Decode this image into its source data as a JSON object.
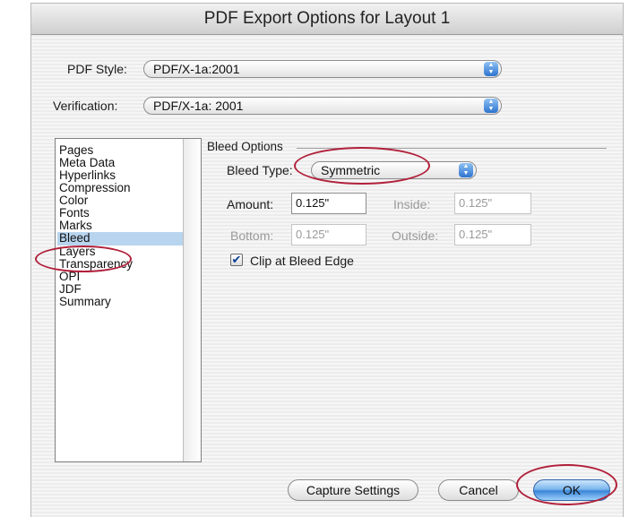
{
  "window": {
    "title": "PDF Export Options for Layout 1"
  },
  "pdf_style": {
    "label": "PDF Style:",
    "value": "PDF/X-1a:2001"
  },
  "verification": {
    "label": "Verification:",
    "value": "PDF/X-1a: 2001"
  },
  "categories": [
    {
      "label": "Pages"
    },
    {
      "label": "Meta Data"
    },
    {
      "label": "Hyperlinks"
    },
    {
      "label": "Compression"
    },
    {
      "label": "Color"
    },
    {
      "label": "Fonts"
    },
    {
      "label": "Marks"
    },
    {
      "label": "Bleed",
      "selected": true
    },
    {
      "label": "Layers"
    },
    {
      "label": "Transparency"
    },
    {
      "label": "OPI"
    },
    {
      "label": "JDF"
    },
    {
      "label": "Summary"
    }
  ],
  "bleed": {
    "group_title": "Bleed Options",
    "type_label": "Bleed Type:",
    "type_value": "Symmetric",
    "amount_label": "Amount:",
    "amount_value": "0.125\"",
    "inside_label": "Inside:",
    "inside_value": "0.125\"",
    "bottom_label": "Bottom:",
    "bottom_value": "0.125\"",
    "outside_label": "Outside:",
    "outside_value": "0.125\"",
    "clip_label": "Clip at Bleed Edge",
    "clip_checked": true
  },
  "buttons": {
    "capture": "Capture Settings",
    "cancel": "Cancel",
    "ok": "OK"
  },
  "colors": {
    "highlight_circle": "#b1203a",
    "selection": "#b8d4ee",
    "accent": "#2c73cf"
  }
}
